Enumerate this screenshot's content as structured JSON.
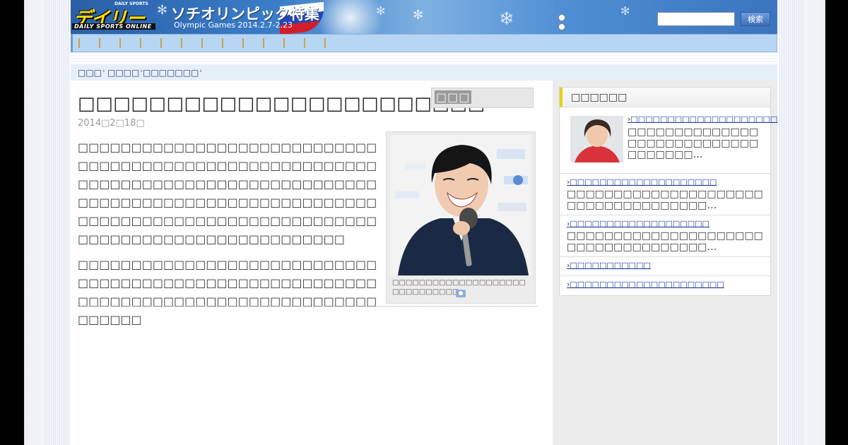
{
  "header": {
    "logo_top": "DAILY SPORTS",
    "logo_main": "デイリー",
    "logo_sub": "DAILY SPORTS ONLINE",
    "feature_title": "ソチオリンピック特集",
    "feature_sub": "Olympic Games 2014.2.7-2.23",
    "search_placeholder": "",
    "search_label": "検索"
  },
  "nav": {
    "item_count": 13
  },
  "breadcrumb": [
    {
      "label": "□□□"
    },
    {
      "label": "□□□□"
    },
    {
      "label": "□□□□□□□"
    }
  ],
  "article": {
    "title": "□□□□□□□□□□□□□□□□□□□□□□□",
    "date": "2014□2□18□",
    "share_label": "□□□",
    "paragraphs": [
      "□□□□□□□□□□□□□□□□□□□□□□□□□□□□□□□□□□□□□□□□□□□□□□□□□□□□□□□□□□□□□□□□□□□□□□□□□□□□□□□□□□□□□□□□□□□□□□□□□□□□□□□□□□□□□□□□□□□□□□□□□□□□□□□□□□□□□□□□□□□□□□□□□□□□□□□□□□□□□□□□□□□□□",
      "□□□□□□□□□□□□□□□□□□□□□□□□□□□□□□□□□□□□□□□□□□□□□□□□□□□□□□□□□□□□□□□□□□□□□□□□□□□□□□□□□□□□□□□□□□"
    ],
    "photo_caption": "□□□□□□□□□□□□□□□□□□□□□□□□□□□□□□"
  },
  "sidebar": {
    "ranking_title": "□□□□□□",
    "items": [
      {
        "link": "□□□□□□□□□□□□□□□□□□□□",
        "text": "□□□□□□□□□□□□□□□□□□□□□□□□□□□□□□□□□□□…",
        "has_thumb": true
      },
      {
        "link": "□□□□□□□□□□□□□□□□□□□□",
        "text": "□□□□□□□□□□□□□□□□□□□□□□□□□□□□□□□□□□□□…"
      },
      {
        "link": "□□□□□□□□□□□□□□□□□□□",
        "text": "□□□□□□□□□□□□□□□□□□□□□□□□□□□□□□□□□□□□…"
      },
      {
        "link": "□□□□□□□□□□□",
        "text": ""
      },
      {
        "link": "□□□□□□□□□□□□□□□□□□□□□",
        "text": ""
      }
    ]
  },
  "colors": {
    "header_blue": "#3b7ec9",
    "nav_bg": "#b7d6f3",
    "link": "#1a3c9c",
    "accent_yellow": "#e6d200"
  }
}
